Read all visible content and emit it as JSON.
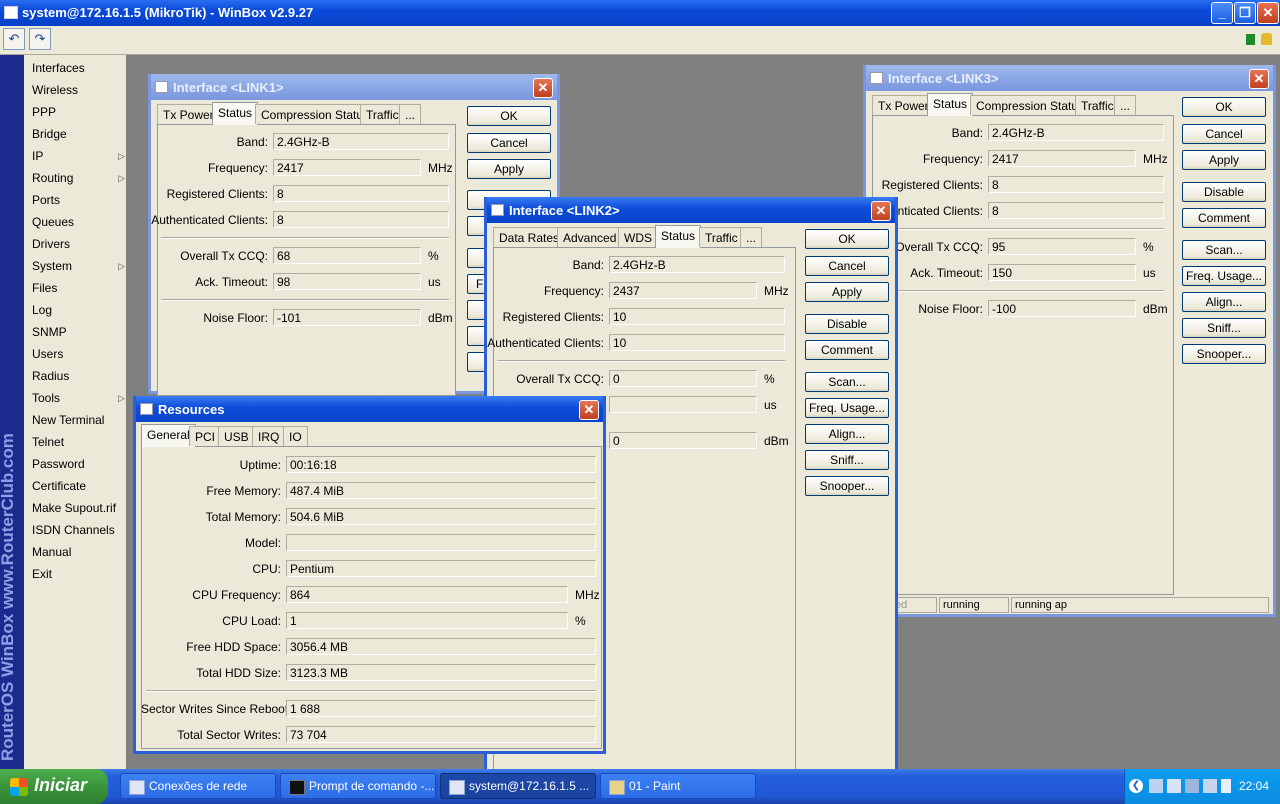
{
  "window": {
    "title": "system@172.16.1.5 (MikroTik) - WinBox v2.9.27"
  },
  "brand": "RouterOS WinBox  www.RouterClub.com",
  "menu": [
    {
      "label": "Interfaces",
      "sub": false
    },
    {
      "label": "Wireless",
      "sub": false
    },
    {
      "label": "PPP",
      "sub": false
    },
    {
      "label": "Bridge",
      "sub": false
    },
    {
      "label": "IP",
      "sub": true
    },
    {
      "label": "Routing",
      "sub": true
    },
    {
      "label": "Ports",
      "sub": false
    },
    {
      "label": "Queues",
      "sub": false
    },
    {
      "label": "Drivers",
      "sub": false
    },
    {
      "label": "System",
      "sub": true
    },
    {
      "label": "Files",
      "sub": false
    },
    {
      "label": "Log",
      "sub": false
    },
    {
      "label": "SNMP",
      "sub": false
    },
    {
      "label": "Users",
      "sub": false
    },
    {
      "label": "Radius",
      "sub": false
    },
    {
      "label": "Tools",
      "sub": true
    },
    {
      "label": "New Terminal",
      "sub": false
    },
    {
      "label": "Telnet",
      "sub": false
    },
    {
      "label": "Password",
      "sub": false
    },
    {
      "label": "Certificate",
      "sub": false
    },
    {
      "label": "Make Supout.rif",
      "sub": false
    },
    {
      "label": "ISDN Channels",
      "sub": false
    },
    {
      "label": "Manual",
      "sub": false
    },
    {
      "label": "Exit",
      "sub": false
    }
  ],
  "submenu_arrow": "▷",
  "close_glyph": "✕",
  "link1": {
    "title": "Interface <LINK1>",
    "tabs": [
      "Tx Power",
      "Status",
      "Compression Status",
      "Traffic",
      "..."
    ],
    "band_label": "Band:",
    "band": "2.4GHz-B",
    "freq_label": "Frequency:",
    "freq": "2417",
    "freq_unit": "MHz",
    "reg_label": "Registered Clients:",
    "reg": "8",
    "auth_label": "Authenticated Clients:",
    "auth": "8",
    "ccq_label": "Overall Tx CCQ:",
    "ccq": "68",
    "ccq_unit": "%",
    "ack_label": "Ack. Timeout:",
    "ack": "98",
    "ack_unit": "us",
    "noise_label": "Noise Floor:",
    "noise": "-101",
    "noise_unit": "dBm",
    "buttons": [
      "OK",
      "Cancel",
      "Apply"
    ],
    "partial_button": "Fr"
  },
  "link2": {
    "title": "Interface <LINK2>",
    "tabs": [
      "Data Rates",
      "Advanced",
      "WDS",
      "Status",
      "Traffic",
      "..."
    ],
    "band_label": "Band:",
    "band": "2.4GHz-B",
    "freq_label": "Frequency:",
    "freq": "2437",
    "freq_unit": "MHz",
    "reg_label": "Registered Clients:",
    "reg": "10",
    "auth_label": "Authenticated Clients:",
    "auth": "10",
    "ccq_label": "Overall Tx CCQ:",
    "ccq": "0",
    "ccq_unit": "%",
    "ack": "",
    "ack_unit": "us",
    "noise": "0",
    "noise_unit": "dBm",
    "buttons": [
      "OK",
      "Cancel",
      "Apply",
      "Disable",
      "Comment",
      "Scan...",
      "Freq. Usage...",
      "Align...",
      "Sniff...",
      "Snooper..."
    ]
  },
  "link3": {
    "title": "Interface <LINK3>",
    "tabs": [
      "Tx Power",
      "Status",
      "Compression Status",
      "Traffic",
      "..."
    ],
    "band_label": "Band:",
    "band": "2.4GHz-B",
    "freq_label": "Frequency:",
    "freq": "2417",
    "freq_unit": "MHz",
    "reg_label": "Registered Clients:",
    "reg": "8",
    "auth_label": "henticated Clients:",
    "auth": "8",
    "ccq_label": "Overall Tx CCQ:",
    "ccq": "95",
    "ccq_unit": "%",
    "ack_label": "Ack. Timeout:",
    "ack": "150",
    "ack_unit": "us",
    "noise_label": "Noise Floor:",
    "noise": "-100",
    "noise_unit": "dBm",
    "buttons": [
      "OK",
      "Cancel",
      "Apply",
      "Disable",
      "Comment",
      "Scan...",
      "Freq. Usage...",
      "Align...",
      "Sniff...",
      "Snooper..."
    ],
    "status": [
      "ed",
      "running",
      "running ap"
    ]
  },
  "resources": {
    "title": "Resources",
    "tabs": [
      "General",
      "PCI",
      "USB",
      "IRQ",
      "IO"
    ],
    "rows": [
      {
        "label": "Uptime:",
        "value": "00:16:18",
        "unit": ""
      },
      {
        "label": "Free Memory:",
        "value": "487.4 MiB",
        "unit": ""
      },
      {
        "label": "Total Memory:",
        "value": "504.6 MiB",
        "unit": ""
      },
      {
        "label": "Model:",
        "value": "",
        "unit": ""
      },
      {
        "label": "CPU:",
        "value": "Pentium",
        "unit": ""
      },
      {
        "label": "CPU Frequency:",
        "value": "864",
        "unit": "MHz"
      },
      {
        "label": "CPU Load:",
        "value": "1",
        "unit": "%"
      },
      {
        "label": "Free HDD Space:",
        "value": "3056.4 MB",
        "unit": ""
      },
      {
        "label": "Total HDD Size:",
        "value": "3123.3 MB",
        "unit": ""
      },
      {
        "label": "Sector Writes Since Reboot:",
        "value": "1 688",
        "unit": ""
      },
      {
        "label": "Total Sector Writes:",
        "value": "73 704",
        "unit": ""
      }
    ]
  },
  "taskbar": {
    "start": "Iniciar",
    "items": [
      "Conexões de rede",
      "Prompt de comando -...",
      "system@172.16.1.5 ...",
      "01 - Paint"
    ],
    "clock": "22:04"
  }
}
